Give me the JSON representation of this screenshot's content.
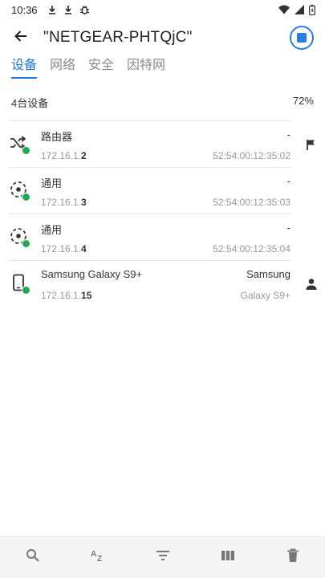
{
  "status_bar": {
    "time": "10:36",
    "icons": [
      "download-icon",
      "download-icon",
      "bug-icon"
    ],
    "right_icons": [
      "wifi-icon",
      "signal-icon",
      "battery-icon"
    ]
  },
  "toolbar": {
    "title": "\"NETGEAR-PHTQjC\"",
    "stop_icon": "stop-scan-icon"
  },
  "tabs": [
    {
      "label": "设备",
      "active": true
    },
    {
      "label": "网络",
      "active": false
    },
    {
      "label": "安全",
      "active": false
    },
    {
      "label": "因特网",
      "active": false
    }
  ],
  "summary": {
    "count_label": "4台设备",
    "percent": "72%"
  },
  "devices": [
    {
      "icon": "router-icon",
      "name": "路由器",
      "ip_prefix": "172.16.1.",
      "ip_suffix": "2",
      "vendor": "-",
      "detail": "52:54:00:12:35:02",
      "side_icon": "flag-icon",
      "status_color": "#22a955"
    },
    {
      "icon": "generic-device-icon",
      "name": "通用",
      "ip_prefix": "172.16.1.",
      "ip_suffix": "3",
      "vendor": "-",
      "detail": "52:54:00:12:35:03",
      "side_icon": "",
      "status_color": "#22a955"
    },
    {
      "icon": "generic-device-icon",
      "name": "通用",
      "ip_prefix": "172.16.1.",
      "ip_suffix": "4",
      "vendor": "-",
      "detail": "52:54:00:12:35:04",
      "side_icon": "",
      "status_color": "#22a955"
    },
    {
      "icon": "phone-icon",
      "name": "Samsung Galaxy S9+",
      "ip_prefix": "172.16.1.",
      "ip_suffix": "15",
      "vendor": "Samsung",
      "detail": "Galaxy S9+",
      "side_icon": "person-icon",
      "status_color": "#22a955"
    }
  ],
  "bottom_bar": {
    "items": [
      "search-icon",
      "sort-az-icon",
      "filter-icon",
      "columns-icon",
      "delete-icon"
    ]
  },
  "colors": {
    "accent": "#1a73e8",
    "online": "#22a955"
  }
}
